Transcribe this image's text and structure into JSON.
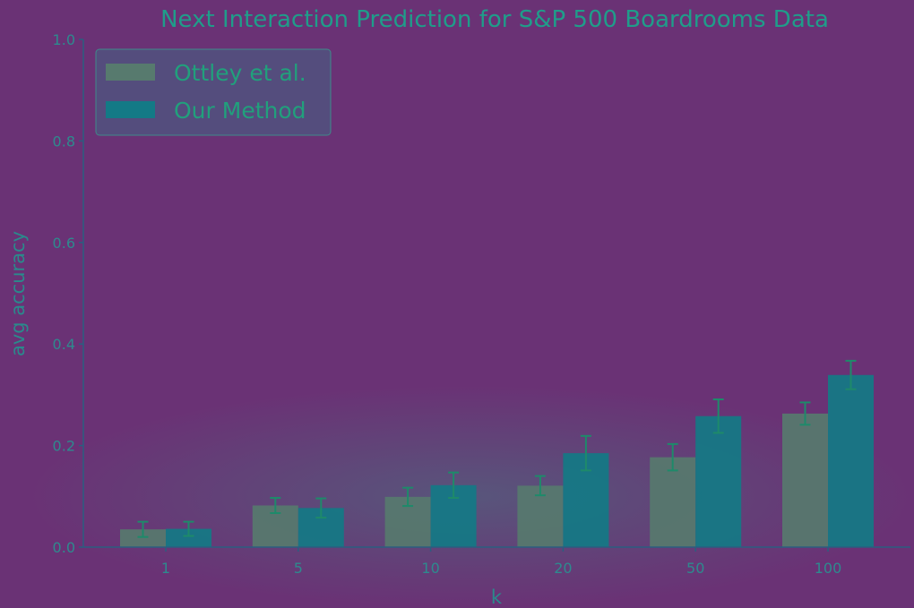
{
  "chart_data": {
    "type": "bar",
    "title": "Next Interaction Prediction for S&P 500 Boardrooms Data",
    "xlabel": "k",
    "ylabel": "avg accuracy",
    "categories": [
      "1",
      "5",
      "10",
      "20",
      "50",
      "100"
    ],
    "ylim": [
      0.0,
      1.0
    ],
    "yticks": [
      "0.0",
      "0.2",
      "0.4",
      "0.6",
      "0.8",
      "1.0"
    ],
    "legend_position": "top-left",
    "grid": false,
    "series": [
      {
        "name": "Ottley et al.",
        "color": "#577a6e",
        "values": [
          0.035,
          0.082,
          0.099,
          0.121,
          0.177,
          0.263
        ],
        "errors": [
          0.015,
          0.015,
          0.018,
          0.019,
          0.026,
          0.022
        ]
      },
      {
        "name": "Our Method",
        "color": "#137a86",
        "values": [
          0.036,
          0.077,
          0.122,
          0.185,
          0.258,
          0.339
        ],
        "errors": [
          0.014,
          0.019,
          0.025,
          0.034,
          0.033,
          0.028
        ]
      }
    ],
    "colors": {
      "background": "#6a3275",
      "axis": "#2b5e80",
      "errorbar": "#1e8a6a",
      "legend_frame": "#3a6f87"
    }
  }
}
